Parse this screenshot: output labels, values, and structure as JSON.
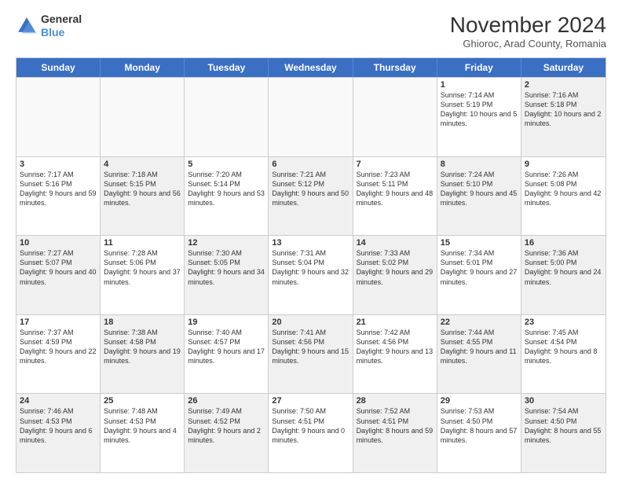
{
  "header": {
    "logo_line1": "General",
    "logo_line2": "Blue",
    "title": "November 2024",
    "subtitle": "Ghioroc, Arad County, Romania"
  },
  "days_of_week": [
    "Sunday",
    "Monday",
    "Tuesday",
    "Wednesday",
    "Thursday",
    "Friday",
    "Saturday"
  ],
  "weeks": [
    [
      {
        "num": "",
        "info": "",
        "empty": true
      },
      {
        "num": "",
        "info": "",
        "empty": true
      },
      {
        "num": "",
        "info": "",
        "empty": true
      },
      {
        "num": "",
        "info": "",
        "empty": true
      },
      {
        "num": "",
        "info": "",
        "empty": true
      },
      {
        "num": "1",
        "info": "Sunrise: 7:14 AM\nSunset: 5:19 PM\nDaylight: 10 hours\nand 5 minutes.",
        "empty": false
      },
      {
        "num": "2",
        "info": "Sunrise: 7:16 AM\nSunset: 5:18 PM\nDaylight: 10 hours\nand 2 minutes.",
        "empty": false,
        "shaded": true
      }
    ],
    [
      {
        "num": "3",
        "info": "Sunrise: 7:17 AM\nSunset: 5:16 PM\nDaylight: 9 hours\nand 59 minutes.",
        "empty": false
      },
      {
        "num": "4",
        "info": "Sunrise: 7:18 AM\nSunset: 5:15 PM\nDaylight: 9 hours\nand 56 minutes.",
        "empty": false,
        "shaded": true
      },
      {
        "num": "5",
        "info": "Sunrise: 7:20 AM\nSunset: 5:14 PM\nDaylight: 9 hours\nand 53 minutes.",
        "empty": false
      },
      {
        "num": "6",
        "info": "Sunrise: 7:21 AM\nSunset: 5:12 PM\nDaylight: 9 hours\nand 50 minutes.",
        "empty": false,
        "shaded": true
      },
      {
        "num": "7",
        "info": "Sunrise: 7:23 AM\nSunset: 5:11 PM\nDaylight: 9 hours\nand 48 minutes.",
        "empty": false
      },
      {
        "num": "8",
        "info": "Sunrise: 7:24 AM\nSunset: 5:10 PM\nDaylight: 9 hours\nand 45 minutes.",
        "empty": false,
        "shaded": true
      },
      {
        "num": "9",
        "info": "Sunrise: 7:26 AM\nSunset: 5:08 PM\nDaylight: 9 hours\nand 42 minutes.",
        "empty": false
      }
    ],
    [
      {
        "num": "10",
        "info": "Sunrise: 7:27 AM\nSunset: 5:07 PM\nDaylight: 9 hours\nand 40 minutes.",
        "empty": false,
        "shaded": true
      },
      {
        "num": "11",
        "info": "Sunrise: 7:28 AM\nSunset: 5:06 PM\nDaylight: 9 hours\nand 37 minutes.",
        "empty": false
      },
      {
        "num": "12",
        "info": "Sunrise: 7:30 AM\nSunset: 5:05 PM\nDaylight: 9 hours\nand 34 minutes.",
        "empty": false,
        "shaded": true
      },
      {
        "num": "13",
        "info": "Sunrise: 7:31 AM\nSunset: 5:04 PM\nDaylight: 9 hours\nand 32 minutes.",
        "empty": false
      },
      {
        "num": "14",
        "info": "Sunrise: 7:33 AM\nSunset: 5:02 PM\nDaylight: 9 hours\nand 29 minutes.",
        "empty": false,
        "shaded": true
      },
      {
        "num": "15",
        "info": "Sunrise: 7:34 AM\nSunset: 5:01 PM\nDaylight: 9 hours\nand 27 minutes.",
        "empty": false
      },
      {
        "num": "16",
        "info": "Sunrise: 7:36 AM\nSunset: 5:00 PM\nDaylight: 9 hours\nand 24 minutes.",
        "empty": false,
        "shaded": true
      }
    ],
    [
      {
        "num": "17",
        "info": "Sunrise: 7:37 AM\nSunset: 4:59 PM\nDaylight: 9 hours\nand 22 minutes.",
        "empty": false
      },
      {
        "num": "18",
        "info": "Sunrise: 7:38 AM\nSunset: 4:58 PM\nDaylight: 9 hours\nand 19 minutes.",
        "empty": false,
        "shaded": true
      },
      {
        "num": "19",
        "info": "Sunrise: 7:40 AM\nSunset: 4:57 PM\nDaylight: 9 hours\nand 17 minutes.",
        "empty": false
      },
      {
        "num": "20",
        "info": "Sunrise: 7:41 AM\nSunset: 4:56 PM\nDaylight: 9 hours\nand 15 minutes.",
        "empty": false,
        "shaded": true
      },
      {
        "num": "21",
        "info": "Sunrise: 7:42 AM\nSunset: 4:56 PM\nDaylight: 9 hours\nand 13 minutes.",
        "empty": false
      },
      {
        "num": "22",
        "info": "Sunrise: 7:44 AM\nSunset: 4:55 PM\nDaylight: 9 hours\nand 11 minutes.",
        "empty": false,
        "shaded": true
      },
      {
        "num": "23",
        "info": "Sunrise: 7:45 AM\nSunset: 4:54 PM\nDaylight: 9 hours\nand 8 minutes.",
        "empty": false
      }
    ],
    [
      {
        "num": "24",
        "info": "Sunrise: 7:46 AM\nSunset: 4:53 PM\nDaylight: 9 hours\nand 6 minutes.",
        "empty": false,
        "shaded": true
      },
      {
        "num": "25",
        "info": "Sunrise: 7:48 AM\nSunset: 4:53 PM\nDaylight: 9 hours\nand 4 minutes.",
        "empty": false
      },
      {
        "num": "26",
        "info": "Sunrise: 7:49 AM\nSunset: 4:52 PM\nDaylight: 9 hours\nand 2 minutes.",
        "empty": false,
        "shaded": true
      },
      {
        "num": "27",
        "info": "Sunrise: 7:50 AM\nSunset: 4:51 PM\nDaylight: 9 hours\nand 0 minutes.",
        "empty": false
      },
      {
        "num": "28",
        "info": "Sunrise: 7:52 AM\nSunset: 4:51 PM\nDaylight: 8 hours\nand 59 minutes.",
        "empty": false,
        "shaded": true
      },
      {
        "num": "29",
        "info": "Sunrise: 7:53 AM\nSunset: 4:50 PM\nDaylight: 8 hours\nand 57 minutes.",
        "empty": false
      },
      {
        "num": "30",
        "info": "Sunrise: 7:54 AM\nSunset: 4:50 PM\nDaylight: 8 hours\nand 55 minutes.",
        "empty": false,
        "shaded": true
      }
    ]
  ]
}
